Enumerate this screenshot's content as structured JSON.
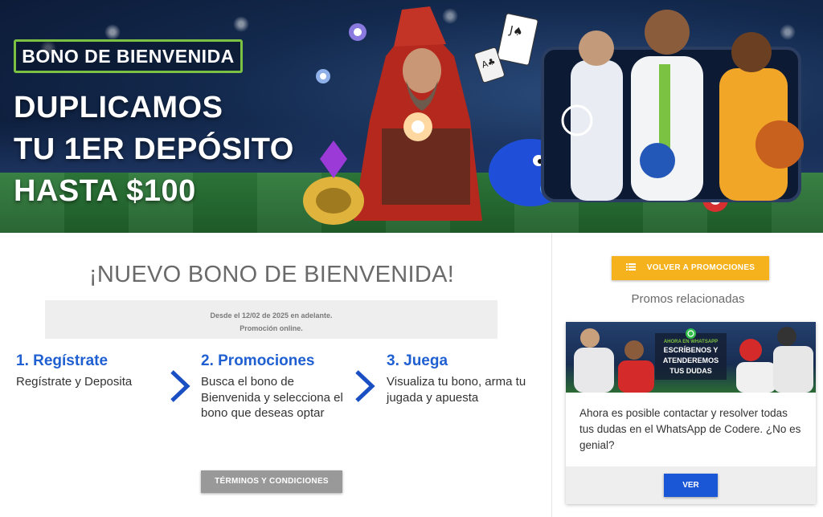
{
  "hero": {
    "badge": "BONO DE BIENVENIDA",
    "headline": [
      "DUPLICAMOS",
      "TU 1ER DEPÓSITO",
      "HASTA $100"
    ]
  },
  "main": {
    "title": "¡NUEVO BONO DE BIENVENIDA!",
    "date_line": "Desde el 12/02 de 2025 en adelante.",
    "online_line": "Promoción online.",
    "steps": [
      {
        "title": "1. Regístrate",
        "text": "Regístrate y Deposita"
      },
      {
        "title": "2. Promociones",
        "text": "Busca el bono de Bienvenida y selecciona el bono que deseas optar"
      },
      {
        "title": "3. Juega",
        "text": "Visualiza tu bono, arma tu jugada y apuesta"
      }
    ],
    "terms_label": "TÉRMINOS Y CONDICIONES"
  },
  "sidebar": {
    "back_label": "VOLVER A PROMOCIONES",
    "related_title": "Promos relacionadas",
    "card": {
      "banner_small": "AHORA EN WHATSAPP",
      "banner_big": [
        "ESCRÍBENOS Y",
        "ATENDEREMOS",
        "TUS DUDAS"
      ],
      "text": "Ahora es posible contactar y resolver todas tus dudas en el WhatsApp de Codere. ¿No es genial?",
      "button_label": "VER"
    }
  },
  "colors": {
    "accent_blue": "#1f5fd1",
    "badge_green": "#7cc242",
    "promo_yellow": "#f5b21d",
    "button_blue": "#1a57d6",
    "terms_gray": "#999999"
  }
}
